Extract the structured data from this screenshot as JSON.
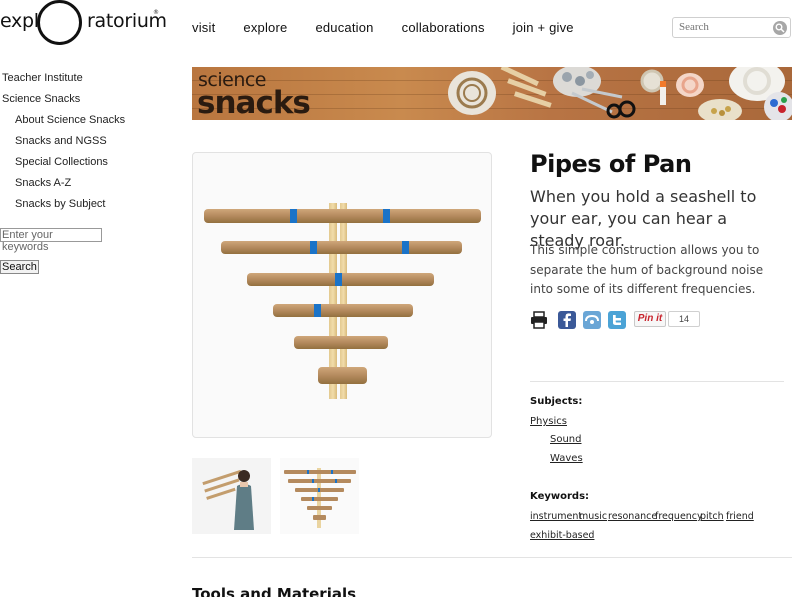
{
  "header": {
    "logo_left": "expl",
    "logo_right": "ratorium",
    "logo_reg": "®",
    "nav": [
      "visit",
      "explore",
      "education",
      "collaborations",
      "join + give"
    ],
    "search_placeholder": "Search"
  },
  "sidebar": {
    "items": [
      {
        "label": "Teacher Institute",
        "level": 1
      },
      {
        "label": "Science Snacks",
        "level": 1
      },
      {
        "label": "About Science Snacks",
        "level": 2
      },
      {
        "label": "Snacks and NGSS",
        "level": 2
      },
      {
        "label": "Special Collections",
        "level": 2
      },
      {
        "label": "Snacks A-Z",
        "level": 2
      },
      {
        "label": "Snacks by Subject",
        "level": 2
      }
    ],
    "search_placeholder": "Enter your keywords",
    "search_button": "Search"
  },
  "banner": {
    "small": "science",
    "big": "snacks"
  },
  "article": {
    "title": "Pipes of Pan",
    "subtitle": "When you hold a seashell to your ear, you can hear a steady roar.",
    "description": "This simple construction allows you to separate the hum of background noise into some of its different frequencies.",
    "pin_label": "Pin it",
    "pin_count": "14"
  },
  "meta": {
    "subjects_label": "Subjects:",
    "subjects": [
      "Physics",
      "Sound",
      "Waves"
    ],
    "keywords_label": "Keywords:",
    "keywords": [
      "instrument",
      "music",
      "resonance",
      "frequency",
      "pitch",
      "friend",
      "exhibit-based"
    ]
  },
  "sections": {
    "tools_title": "Tools and Materials"
  },
  "colors": {
    "facebook": "#3b5998",
    "pinterest": "#c8232c",
    "tape_blue": "#1a73c8",
    "cardboard": "#b48a5e"
  }
}
